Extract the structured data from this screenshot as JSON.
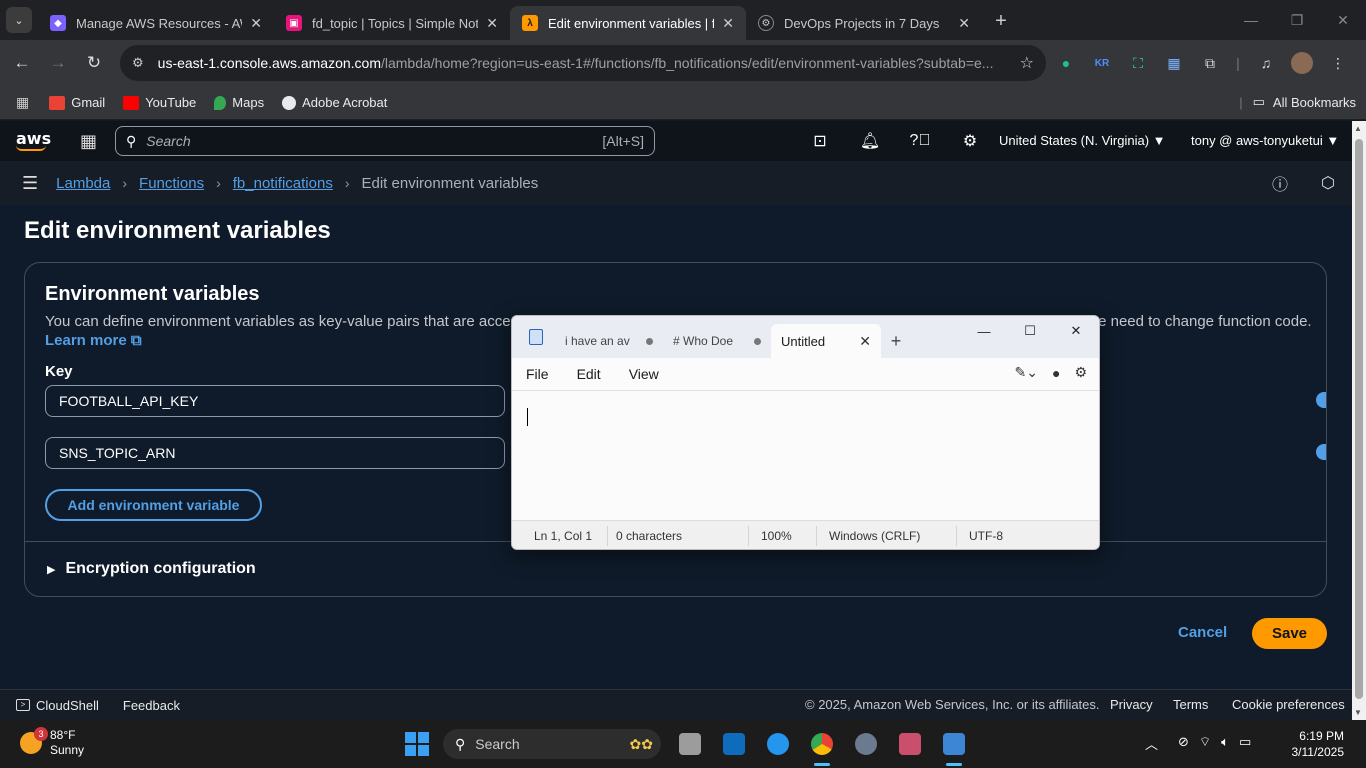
{
  "browser": {
    "tabs": [
      {
        "title": "Manage AWS Resources - AWS",
        "favicon_color": "#7b61ff"
      },
      {
        "title": "fd_topic | Topics | Simple Notific",
        "favicon_color": "#e7157b"
      },
      {
        "title": "Edit environment variables | fb_",
        "favicon_color": "#ff9900"
      },
      {
        "title": "DevOps Projects in 7 Days",
        "favicon_color": "#aaaaaa"
      }
    ],
    "url_host": "us-east-1.console.aws.amazon.com",
    "url_path": "/lambda/home?region=us-east-1#/functions/fb_notifications/edit/environment-variables?subtab=e...",
    "bookmarks": [
      "Gmail",
      "YouTube",
      "Maps",
      "Adobe Acrobat"
    ],
    "all_bookmarks": "All Bookmarks"
  },
  "aws": {
    "logo": "aws",
    "search_placeholder": "Search",
    "search_shortcut": "[Alt+S]",
    "region": "United States (N. Virginia) ▼",
    "account": "tony @ aws-tonyuketui ▼",
    "breadcrumbs": [
      "Lambda",
      "Functions",
      "fb_notifications",
      "Edit environment variables"
    ],
    "page_title": "Edit environment variables",
    "section_title": "Environment variables",
    "description": "You can define environment variables as key-value pairs that are accessible from your function code. These are useful to store configuration settings without the need to change function code.",
    "learn_more": "Learn more",
    "key_label": "Key",
    "keys": [
      "FOOTBALL_API_KEY",
      "SNS_TOPIC_ARN"
    ],
    "add_button": "Add environment variable",
    "encryption": "Encryption configuration",
    "cancel": "Cancel",
    "save": "Save",
    "accent": "#539fe5",
    "save_color": "#ff9900"
  },
  "footer": {
    "cloudshell": "CloudShell",
    "feedback": "Feedback",
    "copyright": "© 2025, Amazon Web Services, Inc. or its affiliates.",
    "privacy": "Privacy",
    "terms": "Terms",
    "cookies": "Cookie preferences"
  },
  "notepad": {
    "tabs": [
      "i have an av",
      "# Who Doe",
      "Untitled"
    ],
    "menu": [
      "File",
      "Edit",
      "View"
    ],
    "status": {
      "position": "Ln 1, Col 1",
      "chars": "0 characters",
      "zoom": "100%",
      "eol": "Windows (CRLF)",
      "encoding": "UTF-8"
    }
  },
  "taskbar": {
    "weather_badge": "3",
    "temp": "88°F",
    "condition": "Sunny",
    "search": "Search",
    "time": "6:19 PM",
    "date": "3/11/2025"
  }
}
